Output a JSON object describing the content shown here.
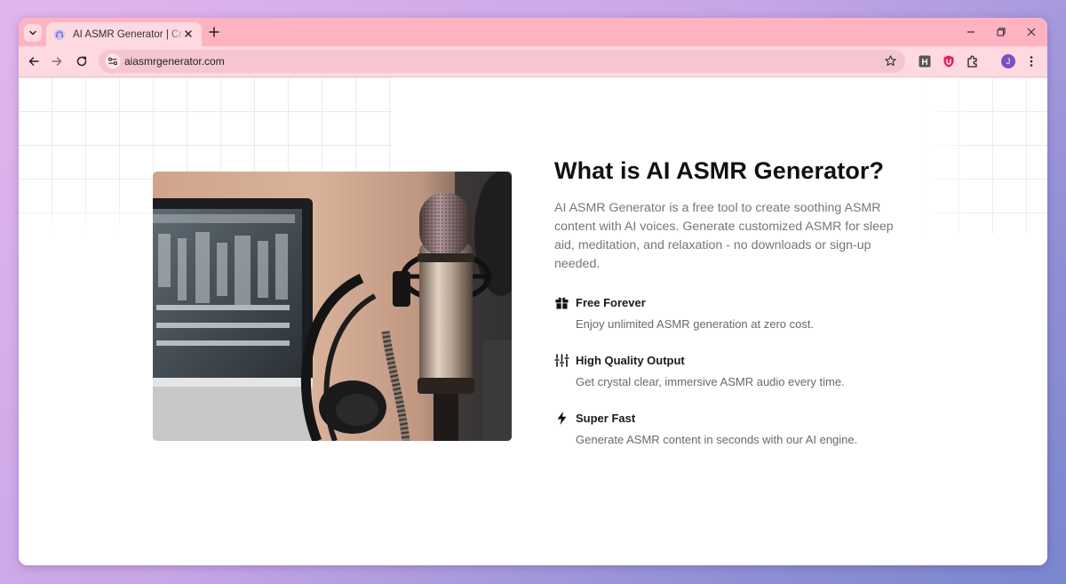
{
  "browser": {
    "tab_title": "AI ASMR Generator | Create Relaxing ASMR",
    "url": "aiasmrgenerator.com",
    "profile_initial": "J",
    "extension_h_label": "H"
  },
  "section": {
    "heading": "What is AI ASMR Generator?",
    "intro": "AI ASMR Generator is a free tool to create soothing ASMR content with AI voices. Generate customized ASMR for sleep aid, meditation, and relaxation - no downloads or sign-up needed.",
    "features": [
      {
        "icon": "gift-icon",
        "title": "Free Forever",
        "description": "Enjoy unlimited ASMR generation at zero cost."
      },
      {
        "icon": "sliders-icon",
        "title": "High Quality Output",
        "description": "Get crystal clear, immersive ASMR audio every time."
      },
      {
        "icon": "lightning-icon",
        "title": "Super Fast",
        "description": "Generate ASMR content in seconds with our AI engine."
      }
    ]
  },
  "colors": {
    "tabstrip": "#ffb3c1",
    "toolbar": "#ffd9e0",
    "omnibox": "#f5c6cf",
    "heading": "#111111",
    "body_text": "#7c7570",
    "profile": "#7a4fc4"
  }
}
